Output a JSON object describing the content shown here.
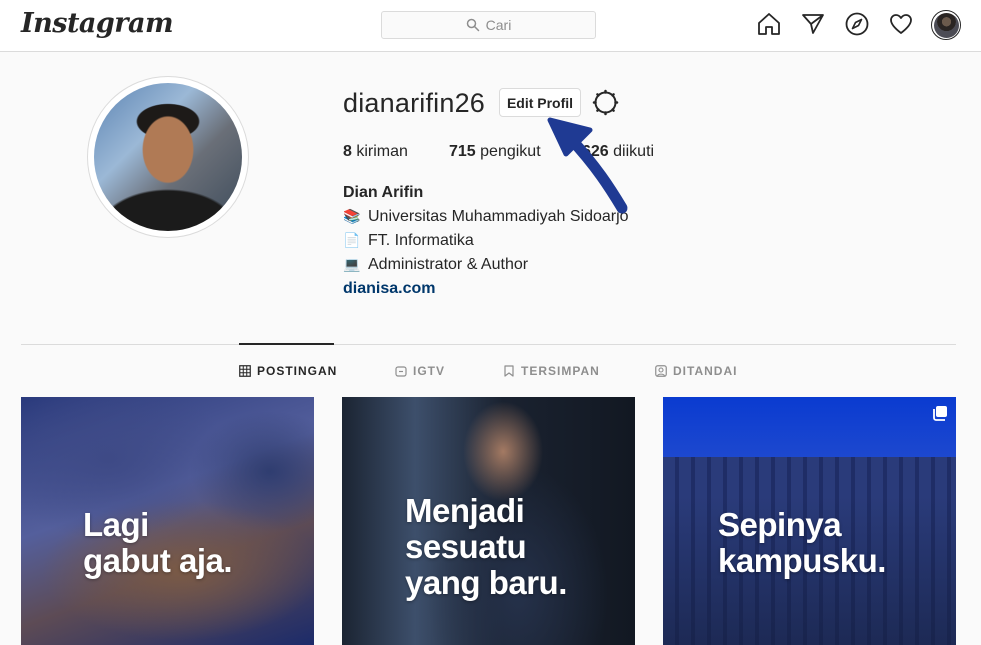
{
  "nav": {
    "logo": "Instagram",
    "search_placeholder": "Cari",
    "icons": [
      "home-icon",
      "direct-icon",
      "explore-icon",
      "activity-icon",
      "profile-avatar"
    ]
  },
  "profile": {
    "username": "dianarifin26",
    "edit_button": "Edit Profil",
    "stats": [
      {
        "count": "8",
        "label": "kiriman"
      },
      {
        "count": "715",
        "label": "pengikut"
      },
      {
        "count": "626",
        "label": "diikuti"
      }
    ],
    "full_name": "Dian Arifin",
    "bio": [
      {
        "icon": "books-emoji",
        "text": "Universitas Muhammadiyah Sidoarjo"
      },
      {
        "icon": "page-emoji",
        "text": "FT. Informatika"
      },
      {
        "icon": "laptop-emoji",
        "text": "Administrator & Author"
      }
    ],
    "website": "dianisa.com"
  },
  "tabs": [
    {
      "label": "POSTINGAN",
      "active": true
    },
    {
      "label": "IGTV",
      "active": false
    },
    {
      "label": "TERSIMPAN",
      "active": false
    },
    {
      "label": "DITANDAI",
      "active": false
    }
  ],
  "posts": [
    {
      "line1": "Lagi",
      "line2": "gabut aja.",
      "multiple": false
    },
    {
      "line1": "Menjadi",
      "line2": "sesuatu",
      "line3": "yang baru.",
      "multiple": false
    },
    {
      "line1": "Sepinya",
      "line2": "kampusku.",
      "multiple": true
    }
  ],
  "annotation": {
    "type": "arrow",
    "color": "#1f3a93",
    "points_to": "edit-profile-button"
  }
}
